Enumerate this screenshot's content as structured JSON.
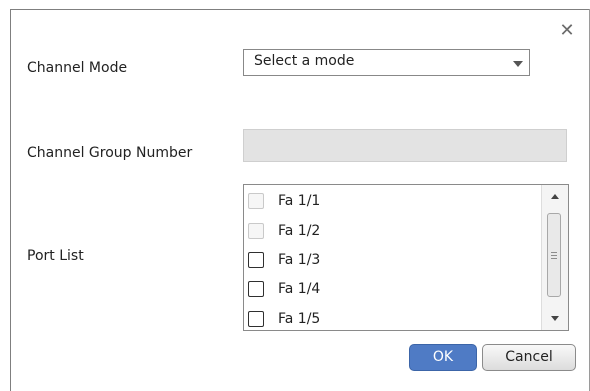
{
  "dialog": {
    "close_icon": "close-icon",
    "close_glyph": "✕"
  },
  "form": {
    "channel_mode_label": "Channel Mode",
    "channel_mode_value": "Select a mode",
    "channel_group_number_label": "Channel Group Number",
    "channel_group_number_value": "",
    "port_list_label": "Port List"
  },
  "port_list": {
    "items": [
      {
        "label": "Fa 1/1",
        "checked": false,
        "enabled": false
      },
      {
        "label": "Fa 1/2",
        "checked": false,
        "enabled": false
      },
      {
        "label": "Fa 1/3",
        "checked": false,
        "enabled": true
      },
      {
        "label": "Fa 1/4",
        "checked": false,
        "enabled": true
      },
      {
        "label": "Fa 1/5",
        "checked": false,
        "enabled": true
      }
    ]
  },
  "buttons": {
    "ok_label": "OK",
    "cancel_label": "Cancel"
  },
  "colors": {
    "primary_button": "#4f7bc5",
    "disabled_input": "#e3e3e3"
  }
}
